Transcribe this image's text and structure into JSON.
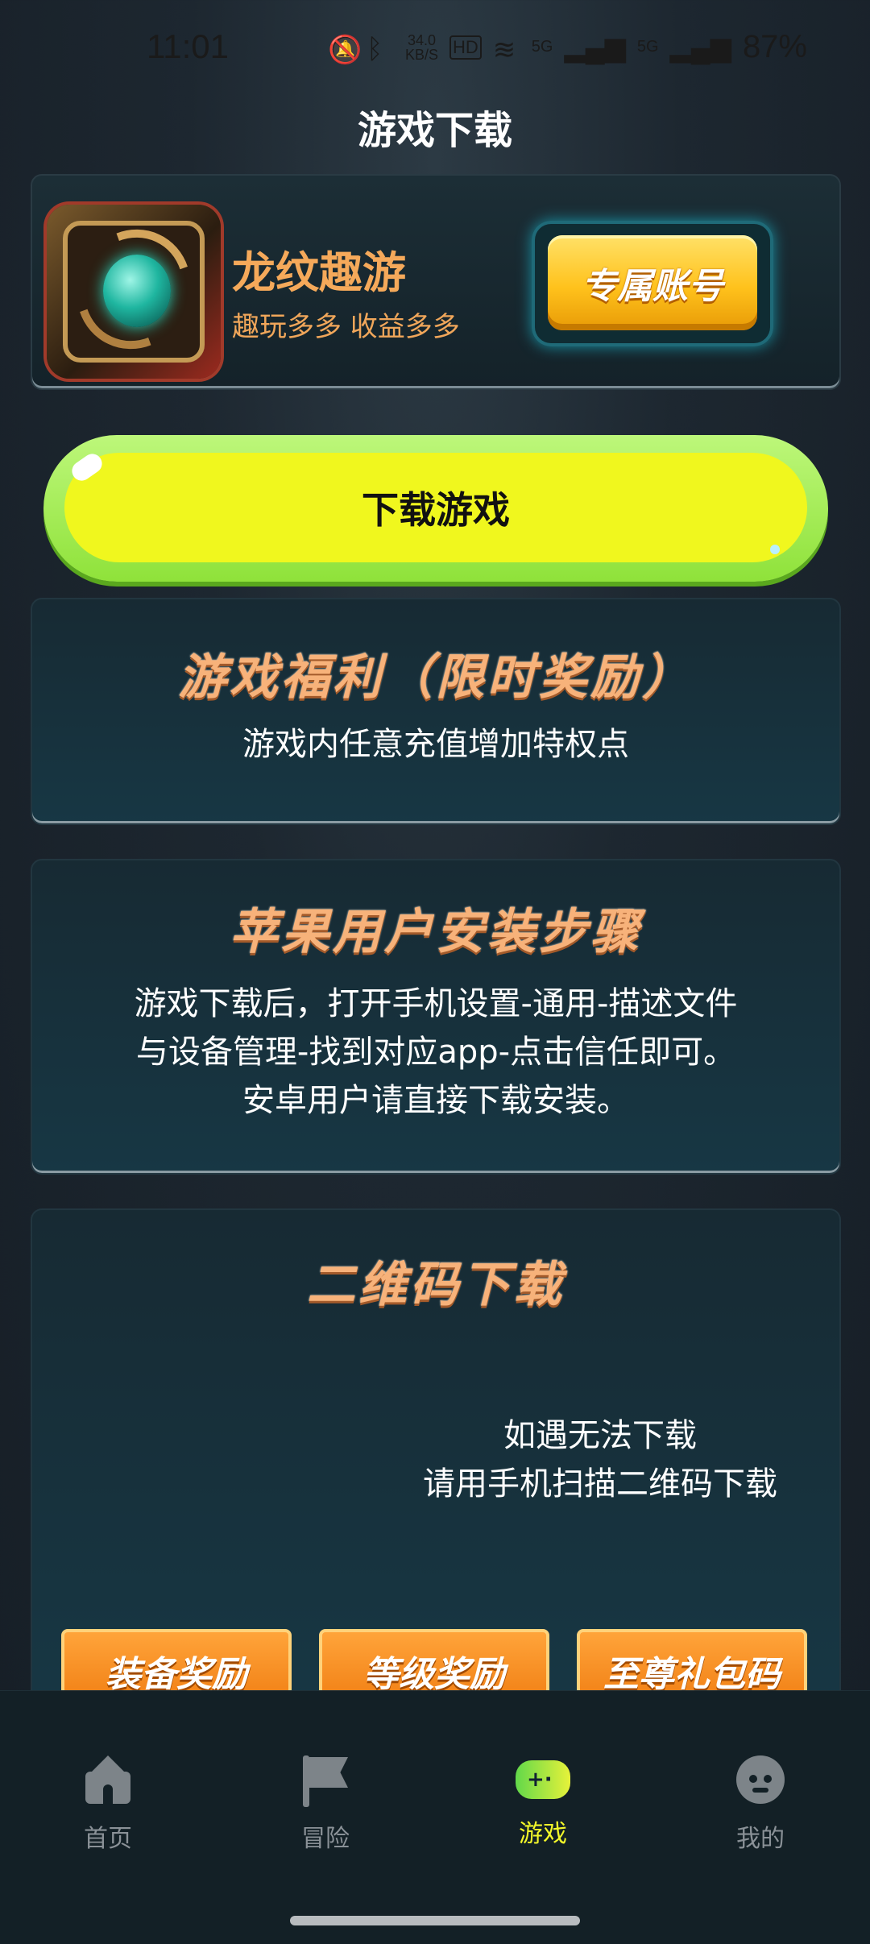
{
  "status_bar": {
    "time": "11:01",
    "speed_value": "34.0",
    "speed_unit": "KB/S",
    "hd_label": "HD",
    "net1": "5G",
    "net2": "5G",
    "battery": "87%"
  },
  "page": {
    "title": "游戏下载"
  },
  "game": {
    "name": "龙纹趣游",
    "slogan": "趣玩多多 收益多多",
    "exclusive_button": "专属账号"
  },
  "download_button": "下载游戏",
  "benefits": {
    "title": "游戏福利（限时奖励）",
    "text": "游戏内任意充值增加特权点"
  },
  "ios_steps": {
    "title": "苹果用户安装步骤",
    "lines": [
      "游戏下载后，打开手机设置-通用-描述文件",
      "与设备管理-找到对应app-点击信任即可。",
      "安卓用户请直接下载安装。"
    ]
  },
  "qr": {
    "title": "二维码下载",
    "hint_lines": [
      "如遇无法下载",
      "请用手机扫描二维码下载"
    ]
  },
  "rewards": [
    "装备奖励",
    "等级奖励",
    "至尊礼包码"
  ],
  "nav": {
    "items": [
      {
        "label": "首页",
        "icon": "home-icon",
        "active": false
      },
      {
        "label": "冒险",
        "icon": "flag-icon",
        "active": false
      },
      {
        "label": "游戏",
        "icon": "gamepad-icon",
        "active": true
      },
      {
        "label": "我的",
        "icon": "profile-icon",
        "active": false
      }
    ]
  },
  "colors": {
    "accent_yellow": "#f3f72a",
    "title_orange": "#f7b27a",
    "download_button": "#f0f71e",
    "card_bg": "#173744"
  }
}
